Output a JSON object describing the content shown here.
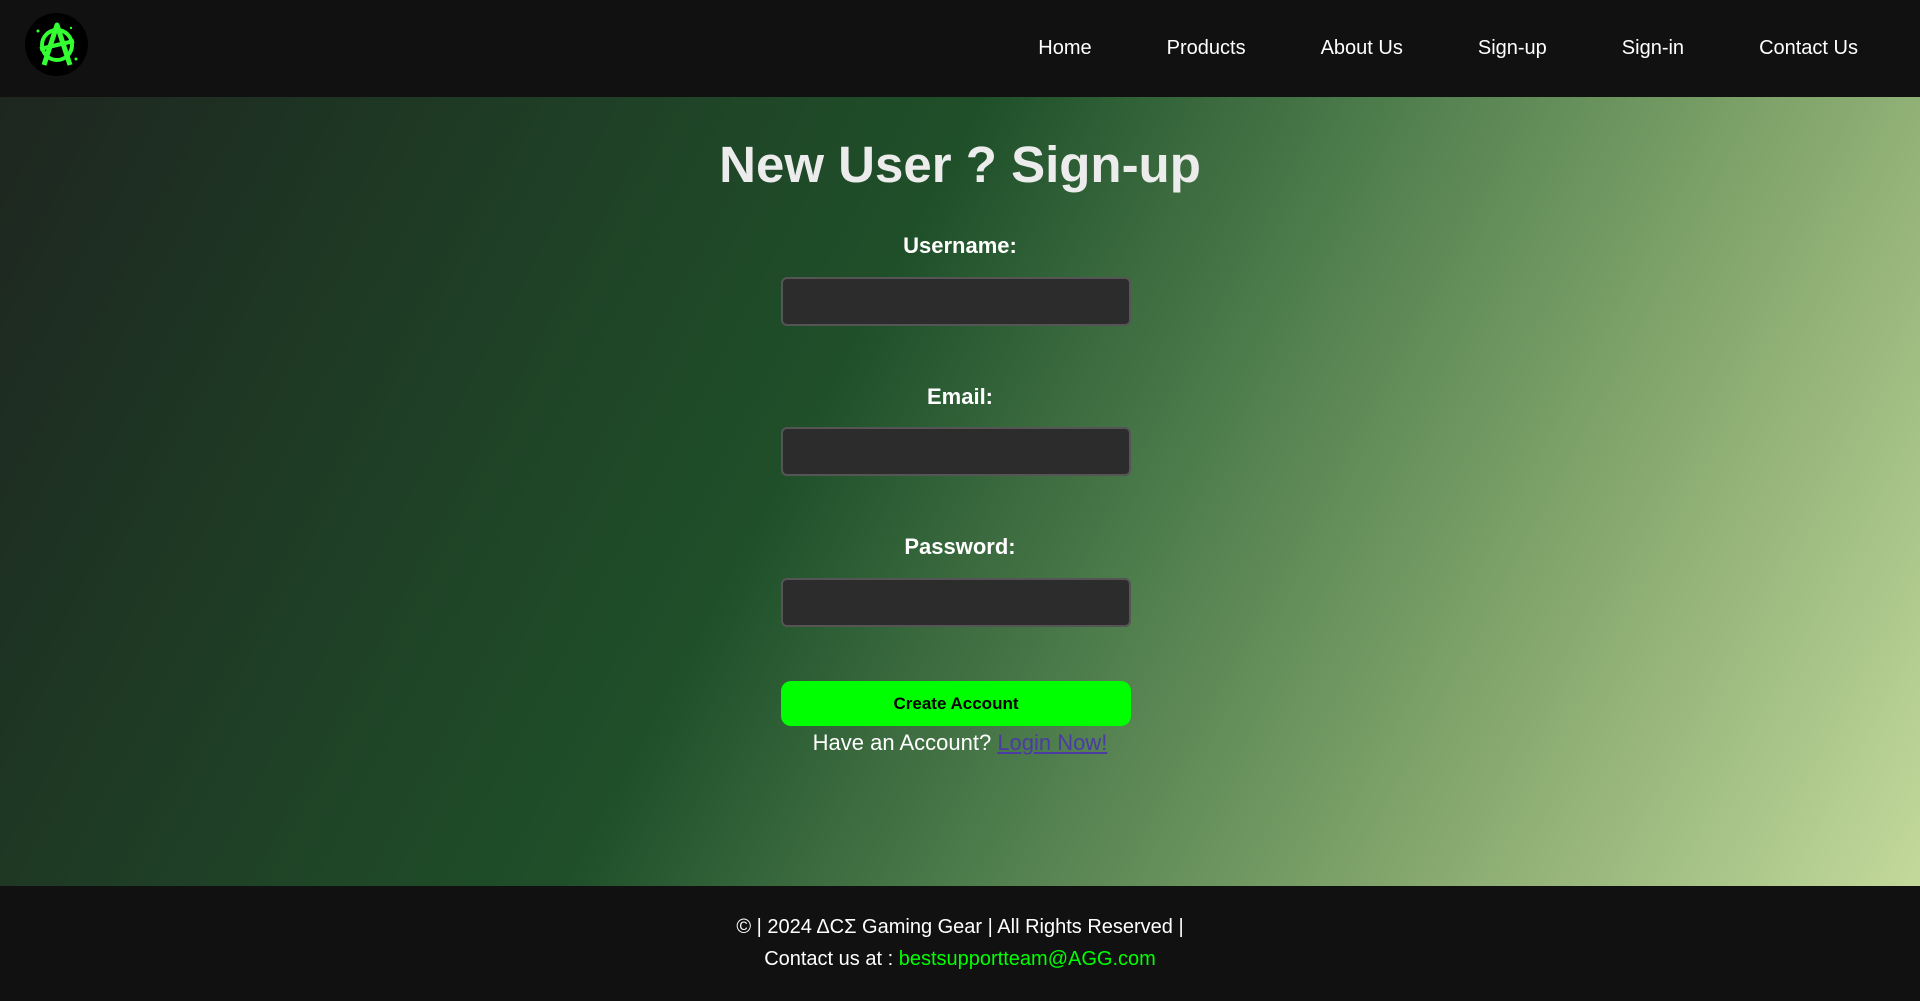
{
  "nav": {
    "logo_icon": "anarchy-a-icon",
    "links": [
      "Home",
      "Products",
      "About Us",
      "Sign-up",
      "Sign-in",
      "Contact Us"
    ]
  },
  "form": {
    "title": "New User ? Sign-up",
    "username_label": "Username:",
    "username_value": "",
    "email_label": "Email:",
    "email_value": "",
    "password_label": "Password:",
    "password_value": "",
    "submit_label": "Create Account",
    "login_prompt": "Have an Account?",
    "login_link": "Login Now!"
  },
  "footer": {
    "copyright": "© | 2024 ΔCΣ Gaming Gear | All Rights Reserved |",
    "contact_prefix": "Contact us at :",
    "contact_email": "bestsupportteam@AGG.com"
  },
  "colors": {
    "accent": "#00ff00",
    "nav_bg": "#111111",
    "link": "#4b3ba3"
  }
}
